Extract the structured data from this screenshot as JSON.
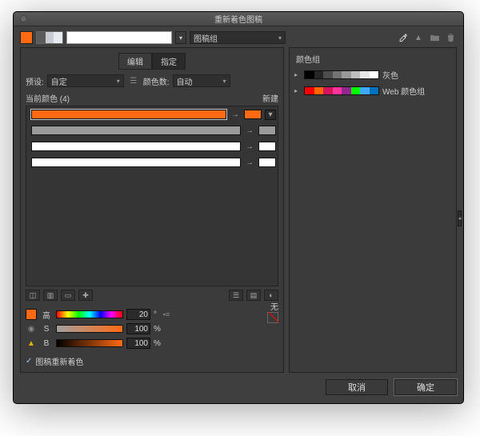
{
  "title": "重新着色图稿",
  "accent": "#ff6a13",
  "top": {
    "half_light": "#c9cdd3",
    "half_lighter": "#e7eaee",
    "group_label": "图稿组"
  },
  "tabs": {
    "edit": "编辑",
    "assign": "指定"
  },
  "preset": {
    "label": "预设:",
    "value": "自定",
    "count_label": "颜色数:",
    "count_value": "自动"
  },
  "panel": {
    "current_label": "当前颜色 (4)",
    "new_label": "新建",
    "rows": [
      {
        "bar": "#ff6a13",
        "chip": "#ff6a13"
      },
      {
        "bar": "#9a9a9a",
        "chip": "#9a9a9a"
      },
      {
        "bar": "#ffffff",
        "chip": "#ffffff"
      },
      {
        "bar": "#ffffff",
        "chip": "#ffffff"
      }
    ]
  },
  "hsb": {
    "none": "无",
    "h_label": "高",
    "h_value": "20",
    "h_deg": "°",
    "s_label": "S",
    "s_value": "100",
    "s_unit": "%",
    "b_label": "B",
    "b_value": "100",
    "b_unit": "%"
  },
  "checkbox": "图稿重新着色",
  "groups": {
    "title": "颜色组",
    "list": [
      {
        "name": "灰色",
        "colors": [
          "#000000",
          "#262626",
          "#4d4d4d",
          "#737373",
          "#999999",
          "#bfbfbf",
          "#e6e6e6",
          "#ffffff"
        ]
      },
      {
        "name": "Web 颜色组",
        "colors": [
          "#ff0000",
          "#ff6600",
          "#d4145a",
          "#ff3399",
          "#93278f",
          "#00ff00",
          "#3fa9f5",
          "#0071bc"
        ]
      }
    ]
  },
  "footer": {
    "cancel": "取消",
    "ok": "确定"
  }
}
